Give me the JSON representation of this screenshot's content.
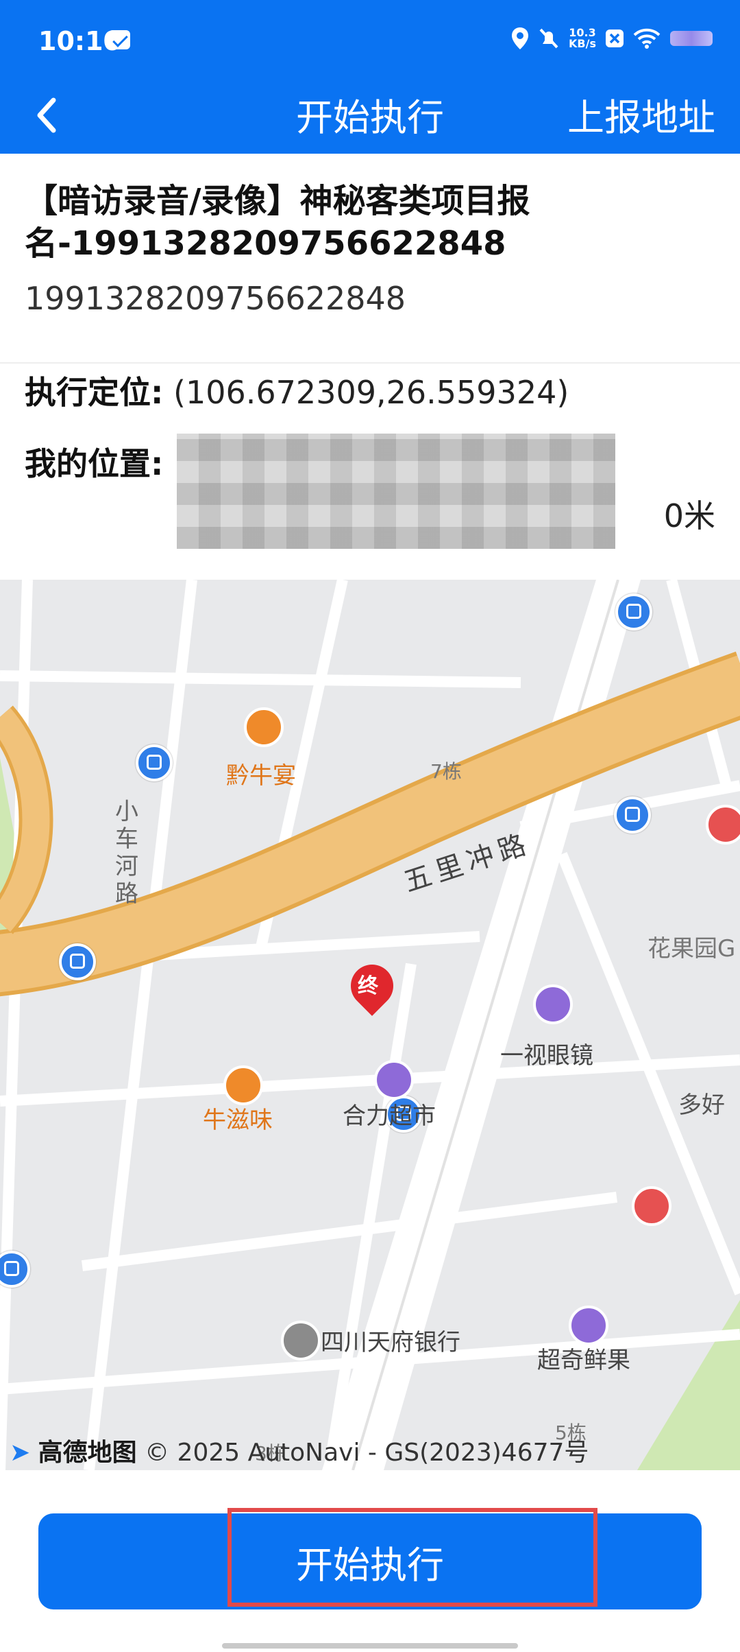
{
  "status_bar": {
    "time": "10:10",
    "net_speed_top": "10.3",
    "net_speed_bottom": "KB/s",
    "icons": [
      "mail-icon",
      "location-icon",
      "mute-icon",
      "close-box-icon",
      "wifi-icon",
      "battery-icon"
    ]
  },
  "titlebar": {
    "title": "开始执行",
    "action": "上报地址",
    "back_icon": "chevron-left-icon"
  },
  "task": {
    "title": "【暗访录音/录像】神秘客类项目报名-1991328209756622848",
    "id": "1991328209756622848"
  },
  "execution_location": {
    "label": "执行定位:",
    "value": "(106.672309,26.559324)"
  },
  "my_location": {
    "label": "我的位置:",
    "distance": "0米"
  },
  "map": {
    "pois": {
      "qian_niu_yan": "黔牛宴",
      "building_7": "7栋",
      "xiao_che_he_lu": "小车河路",
      "wu_li_chong_lu": "五里冲路",
      "hua_guo_yuan": "花果园G",
      "yi_shi_yan_jing": "一视眼镜",
      "duo_hao": "多好",
      "niu_zi_wei": "牛滋味",
      "he_li_chao_shi": "合力超市",
      "sichuan_bank": "四川天府银行",
      "chao_qi_xian_guo": "超奇鲜果",
      "building_5": "5栋",
      "building_3": "3栋"
    },
    "marker_text": "终",
    "attribution_logo": "高德地图",
    "attribution": "© 2025 AutoNavi - GS(2023)4677号",
    "colors": {
      "main_road": "#f1c27a",
      "road_edge": "#e4a84a",
      "block": "#e7e8ea",
      "street": "#ffffff",
      "park": "#cfe8b3"
    }
  },
  "buttons": {
    "start": "开始执行"
  },
  "colors": {
    "primary": "#0a73f2",
    "highlight": "#e24a4a",
    "marker": "#e0272d"
  }
}
